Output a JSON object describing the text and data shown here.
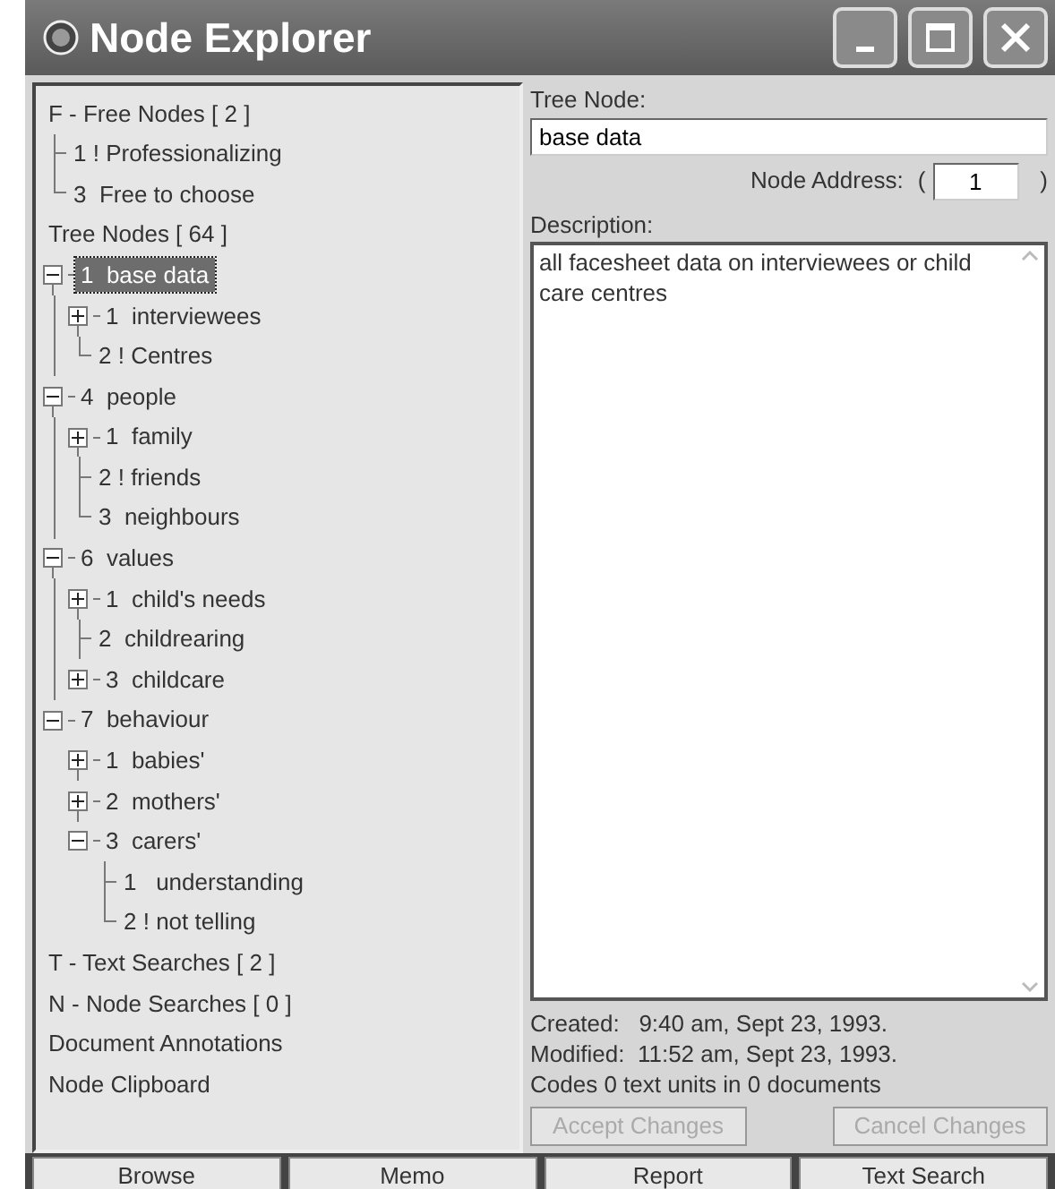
{
  "window": {
    "title": "Node Explorer",
    "controls": [
      {
        "kind": "minimize"
      },
      {
        "kind": "maximize"
      },
      {
        "kind": "close"
      }
    ]
  },
  "tree": [
    {
      "text": "F - Free Nodes [ 2 ]",
      "kind": "root",
      "selected": false,
      "children": [
        {
          "text": "1 ! Professionalizing",
          "kind": "leaf",
          "selected": false
        },
        {
          "text": "3  Free to choose",
          "kind": "leaf",
          "selected": false
        }
      ]
    },
    {
      "text": "Tree Nodes [ 64 ]",
      "kind": "root",
      "selected": false,
      "children": [
        {
          "text": "1  base data",
          "kind": "branch",
          "expanded": true,
          "selected": true,
          "children": [
            {
              "text": "1  interviewees",
              "kind": "branch",
              "expanded": false,
              "selected": false
            },
            {
              "text": "2 ! Centres",
              "kind": "leaf",
              "selected": false
            }
          ]
        },
        {
          "text": "4  people",
          "kind": "branch",
          "expanded": true,
          "selected": false,
          "children": [
            {
              "text": "1  family",
              "kind": "branch",
              "expanded": false,
              "selected": false
            },
            {
              "text": "2 ! friends",
              "kind": "leaf",
              "selected": false
            },
            {
              "text": "3  neighbours",
              "kind": "leaf",
              "selected": false
            }
          ]
        },
        {
          "text": "6  values",
          "kind": "branch",
          "expanded": true,
          "selected": false,
          "children": [
            {
              "text": "1  child's needs",
              "kind": "branch",
              "expanded": false,
              "selected": false
            },
            {
              "text": "2  childrearing",
              "kind": "leaf",
              "selected": false
            },
            {
              "text": "3  childcare",
              "kind": "branch",
              "expanded": false,
              "selected": false
            }
          ]
        },
        {
          "text": "7  behaviour",
          "kind": "branch",
          "expanded": true,
          "selected": false,
          "children": [
            {
              "text": "1  babies'",
              "kind": "branch",
              "expanded": false,
              "selected": false
            },
            {
              "text": "2  mothers'",
              "kind": "branch",
              "expanded": false,
              "selected": false
            },
            {
              "text": "3  carers'",
              "kind": "branch",
              "expanded": true,
              "selected": false,
              "children": [
                {
                  "text": "1   understanding",
                  "kind": "leaf",
                  "selected": false
                },
                {
                  "text": "2 ! not telling",
                  "kind": "leaf",
                  "selected": false
                }
              ]
            }
          ]
        }
      ]
    },
    {
      "text": "T - Text Searches [ 2 ]",
      "kind": "root",
      "selected": false
    },
    {
      "text": "N - Node Searches [ 0 ]",
      "kind": "root",
      "selected": false
    },
    {
      "text": "Document Annotations",
      "kind": "root",
      "selected": false
    },
    {
      "text": "Node Clipboard",
      "kind": "root",
      "selected": false
    }
  ],
  "detail": {
    "tree_node_label": "Tree Node:",
    "tree_node_value": "base data",
    "address_label": "Node Address:",
    "address_open": "(",
    "address_value": "1",
    "address_close": ")",
    "description_label": "Description:",
    "description": "all facesheet data on interviewees or child care centres",
    "info": [
      "Created:   9:40 am, Sept 23, 1993.",
      "Modified:  11:52 am, Sept 23, 1993.",
      "Codes 0 text units in 0 documents"
    ],
    "buttons": [
      {
        "label": "Accept Changes",
        "disabled": true
      },
      {
        "label": "Cancel Changes",
        "disabled": true
      }
    ]
  },
  "bottom_buttons": [
    "Browse",
    "Memo",
    "Report",
    "Text Search"
  ]
}
